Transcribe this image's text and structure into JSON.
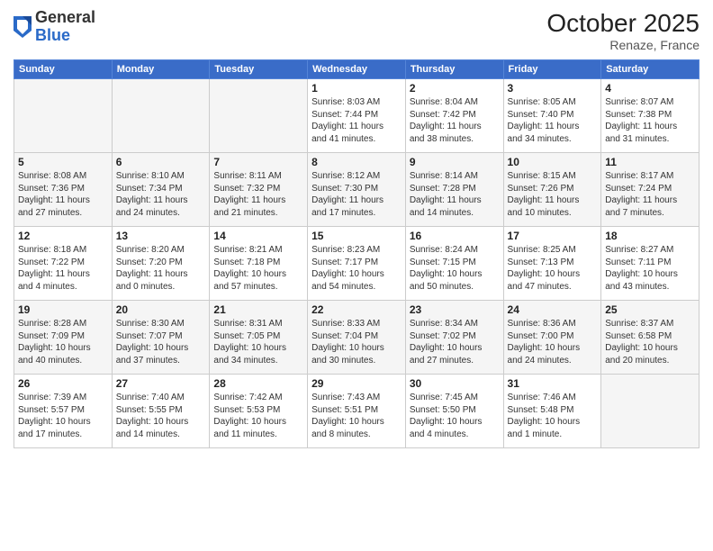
{
  "header": {
    "logo_general": "General",
    "logo_blue": "Blue",
    "month_title": "October 2025",
    "location": "Renaze, France"
  },
  "weekdays": [
    "Sunday",
    "Monday",
    "Tuesday",
    "Wednesday",
    "Thursday",
    "Friday",
    "Saturday"
  ],
  "weeks": [
    [
      {
        "day": "",
        "info": ""
      },
      {
        "day": "",
        "info": ""
      },
      {
        "day": "",
        "info": ""
      },
      {
        "day": "1",
        "info": "Sunrise: 8:03 AM\nSunset: 7:44 PM\nDaylight: 11 hours\nand 41 minutes."
      },
      {
        "day": "2",
        "info": "Sunrise: 8:04 AM\nSunset: 7:42 PM\nDaylight: 11 hours\nand 38 minutes."
      },
      {
        "day": "3",
        "info": "Sunrise: 8:05 AM\nSunset: 7:40 PM\nDaylight: 11 hours\nand 34 minutes."
      },
      {
        "day": "4",
        "info": "Sunrise: 8:07 AM\nSunset: 7:38 PM\nDaylight: 11 hours\nand 31 minutes."
      }
    ],
    [
      {
        "day": "5",
        "info": "Sunrise: 8:08 AM\nSunset: 7:36 PM\nDaylight: 11 hours\nand 27 minutes."
      },
      {
        "day": "6",
        "info": "Sunrise: 8:10 AM\nSunset: 7:34 PM\nDaylight: 11 hours\nand 24 minutes."
      },
      {
        "day": "7",
        "info": "Sunrise: 8:11 AM\nSunset: 7:32 PM\nDaylight: 11 hours\nand 21 minutes."
      },
      {
        "day": "8",
        "info": "Sunrise: 8:12 AM\nSunset: 7:30 PM\nDaylight: 11 hours\nand 17 minutes."
      },
      {
        "day": "9",
        "info": "Sunrise: 8:14 AM\nSunset: 7:28 PM\nDaylight: 11 hours\nand 14 minutes."
      },
      {
        "day": "10",
        "info": "Sunrise: 8:15 AM\nSunset: 7:26 PM\nDaylight: 11 hours\nand 10 minutes."
      },
      {
        "day": "11",
        "info": "Sunrise: 8:17 AM\nSunset: 7:24 PM\nDaylight: 11 hours\nand 7 minutes."
      }
    ],
    [
      {
        "day": "12",
        "info": "Sunrise: 8:18 AM\nSunset: 7:22 PM\nDaylight: 11 hours\nand 4 minutes."
      },
      {
        "day": "13",
        "info": "Sunrise: 8:20 AM\nSunset: 7:20 PM\nDaylight: 11 hours\nand 0 minutes."
      },
      {
        "day": "14",
        "info": "Sunrise: 8:21 AM\nSunset: 7:18 PM\nDaylight: 10 hours\nand 57 minutes."
      },
      {
        "day": "15",
        "info": "Sunrise: 8:23 AM\nSunset: 7:17 PM\nDaylight: 10 hours\nand 54 minutes."
      },
      {
        "day": "16",
        "info": "Sunrise: 8:24 AM\nSunset: 7:15 PM\nDaylight: 10 hours\nand 50 minutes."
      },
      {
        "day": "17",
        "info": "Sunrise: 8:25 AM\nSunset: 7:13 PM\nDaylight: 10 hours\nand 47 minutes."
      },
      {
        "day": "18",
        "info": "Sunrise: 8:27 AM\nSunset: 7:11 PM\nDaylight: 10 hours\nand 43 minutes."
      }
    ],
    [
      {
        "day": "19",
        "info": "Sunrise: 8:28 AM\nSunset: 7:09 PM\nDaylight: 10 hours\nand 40 minutes."
      },
      {
        "day": "20",
        "info": "Sunrise: 8:30 AM\nSunset: 7:07 PM\nDaylight: 10 hours\nand 37 minutes."
      },
      {
        "day": "21",
        "info": "Sunrise: 8:31 AM\nSunset: 7:05 PM\nDaylight: 10 hours\nand 34 minutes."
      },
      {
        "day": "22",
        "info": "Sunrise: 8:33 AM\nSunset: 7:04 PM\nDaylight: 10 hours\nand 30 minutes."
      },
      {
        "day": "23",
        "info": "Sunrise: 8:34 AM\nSunset: 7:02 PM\nDaylight: 10 hours\nand 27 minutes."
      },
      {
        "day": "24",
        "info": "Sunrise: 8:36 AM\nSunset: 7:00 PM\nDaylight: 10 hours\nand 24 minutes."
      },
      {
        "day": "25",
        "info": "Sunrise: 8:37 AM\nSunset: 6:58 PM\nDaylight: 10 hours\nand 20 minutes."
      }
    ],
    [
      {
        "day": "26",
        "info": "Sunrise: 7:39 AM\nSunset: 5:57 PM\nDaylight: 10 hours\nand 17 minutes."
      },
      {
        "day": "27",
        "info": "Sunrise: 7:40 AM\nSunset: 5:55 PM\nDaylight: 10 hours\nand 14 minutes."
      },
      {
        "day": "28",
        "info": "Sunrise: 7:42 AM\nSunset: 5:53 PM\nDaylight: 10 hours\nand 11 minutes."
      },
      {
        "day": "29",
        "info": "Sunrise: 7:43 AM\nSunset: 5:51 PM\nDaylight: 10 hours\nand 8 minutes."
      },
      {
        "day": "30",
        "info": "Sunrise: 7:45 AM\nSunset: 5:50 PM\nDaylight: 10 hours\nand 4 minutes."
      },
      {
        "day": "31",
        "info": "Sunrise: 7:46 AM\nSunset: 5:48 PM\nDaylight: 10 hours\nand 1 minute."
      },
      {
        "day": "",
        "info": ""
      }
    ]
  ]
}
